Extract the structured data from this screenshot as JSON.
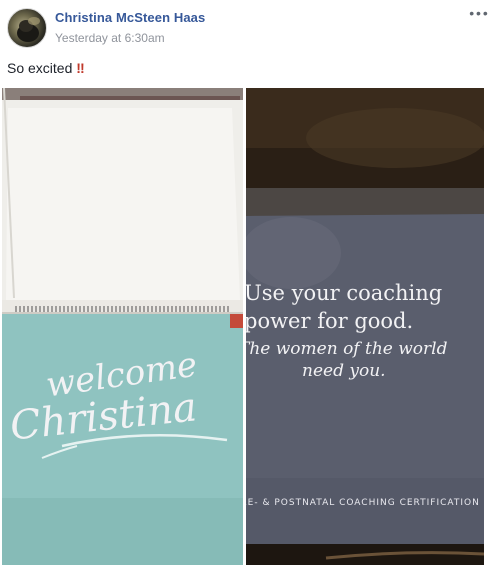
{
  "post": {
    "author": "Christina McSteen Haas",
    "timestamp": "Yesterday at 6:30am",
    "text": "So excited",
    "emoji": "‼",
    "more_icon": "ellipsis-icon"
  },
  "photos": {
    "left": {
      "line1": "welcome",
      "line2": "Christina"
    },
    "right": {
      "line1": "Use your coaching",
      "line2": "power for good.",
      "line3": "The women of the world",
      "line4": "need you.",
      "footer": "PRE- & POSTNATAL COACHING CERTIFICATION"
    }
  },
  "colors": {
    "author_link": "#365899",
    "meta_gray": "#90949c",
    "teal_card": "#8fc3c0",
    "gray_box": "#585c6b"
  }
}
